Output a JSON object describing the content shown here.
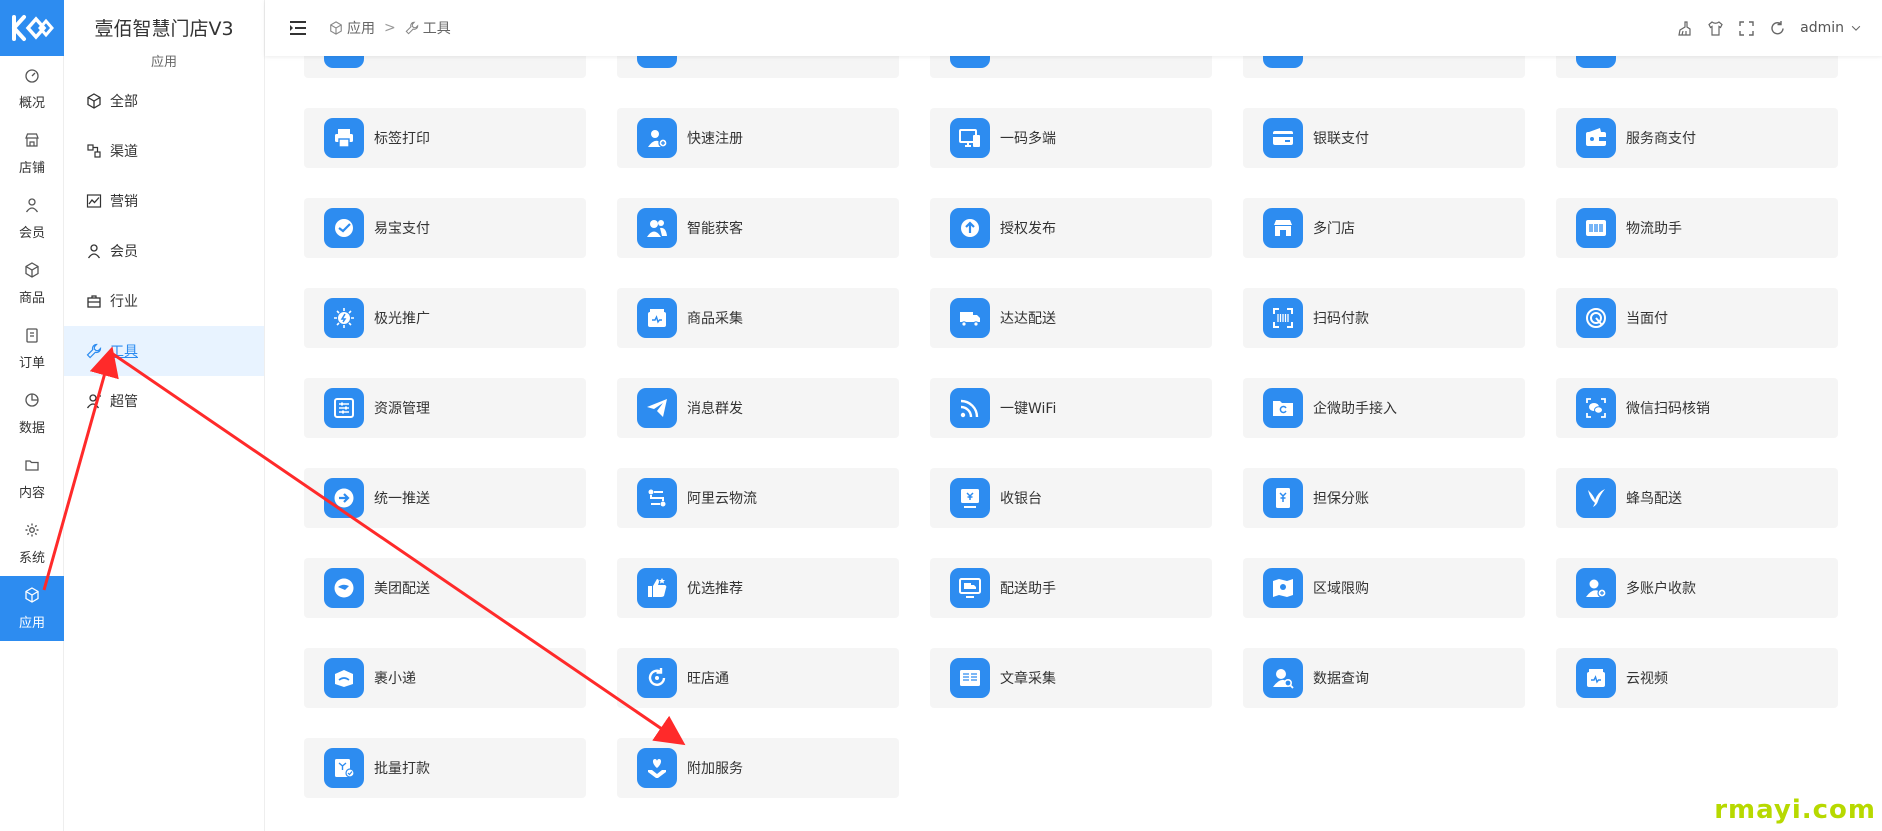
{
  "rail": {
    "items": [
      {
        "label": "概况",
        "icon": "dashboard-icon"
      },
      {
        "label": "店铺",
        "icon": "store-icon"
      },
      {
        "label": "会员",
        "icon": "user-icon"
      },
      {
        "label": "商品",
        "icon": "box-icon"
      },
      {
        "label": "订单",
        "icon": "order-icon"
      },
      {
        "label": "数据",
        "icon": "pie-icon"
      },
      {
        "label": "内容",
        "icon": "folder-icon"
      },
      {
        "label": "系统",
        "icon": "gear-icon"
      },
      {
        "label": "应用",
        "icon": "cube-icon",
        "active": true
      }
    ]
  },
  "brand": {
    "name": "壹佰智慧门店V3",
    "section": "应用"
  },
  "submenu": {
    "items": [
      {
        "label": "全部",
        "icon": "cube-icon"
      },
      {
        "label": "渠道",
        "icon": "channel-icon"
      },
      {
        "label": "营销",
        "icon": "chart-icon"
      },
      {
        "label": "会员",
        "icon": "user-icon"
      },
      {
        "label": "行业",
        "icon": "briefcase-icon"
      },
      {
        "label": "工具",
        "icon": "wrench-icon",
        "active": true
      },
      {
        "label": "超管",
        "icon": "admin-icon"
      }
    ]
  },
  "header": {
    "crumb1": "应用",
    "crumb_sep": ">",
    "crumb2": "工具",
    "user": "admin"
  },
  "apps": [
    {
      "label": "",
      "icon": "app-icon"
    },
    {
      "label": "",
      "icon": "app-icon"
    },
    {
      "label": "",
      "icon": "app-icon"
    },
    {
      "label": "",
      "icon": "app-icon"
    },
    {
      "label": "",
      "icon": "app-icon"
    },
    {
      "label": "标签打印",
      "icon": "printer-icon"
    },
    {
      "label": "快速注册",
      "icon": "user-add-icon"
    },
    {
      "label": "一码多端",
      "icon": "devices-icon"
    },
    {
      "label": "银联支付",
      "icon": "card-icon"
    },
    {
      "label": "服务商支付",
      "icon": "wallet-icon"
    },
    {
      "label": "易宝支付",
      "icon": "check-circle-icon"
    },
    {
      "label": "智能获客",
      "icon": "users-icon"
    },
    {
      "label": "授权发布",
      "icon": "upload-icon"
    },
    {
      "label": "多门店",
      "icon": "shops-icon"
    },
    {
      "label": "物流助手",
      "icon": "barcode-box-icon"
    },
    {
      "label": "极光推广",
      "icon": "aurora-icon"
    },
    {
      "label": "商品采集",
      "icon": "collect-icon"
    },
    {
      "label": "达达配送",
      "icon": "truck-icon"
    },
    {
      "label": "扫码付款",
      "icon": "scan-icon"
    },
    {
      "label": "当面付",
      "icon": "fingerprint-icon"
    },
    {
      "label": "资源管理",
      "icon": "sliders-icon"
    },
    {
      "label": "消息群发",
      "icon": "send-icon"
    },
    {
      "label": "一键WiFi",
      "icon": "wifi-icon"
    },
    {
      "label": "企微助手接入",
      "icon": "folder-sync-icon"
    },
    {
      "label": "微信扫码核销",
      "icon": "wechat-scan-icon"
    },
    {
      "label": "统一推送",
      "icon": "arrow-right-circle-icon"
    },
    {
      "label": "阿里云物流",
      "icon": "route-icon"
    },
    {
      "label": "收银台",
      "icon": "cashier-icon"
    },
    {
      "label": "担保分账",
      "icon": "yen-doc-icon"
    },
    {
      "label": "蜂鸟配送",
      "icon": "bird-icon"
    },
    {
      "label": "美团配送",
      "icon": "meituan-icon"
    },
    {
      "label": "优选推荐",
      "icon": "thumbs-up-icon"
    },
    {
      "label": "配送助手",
      "icon": "monitor-truck-icon"
    },
    {
      "label": "区域限购",
      "icon": "map-pin-icon"
    },
    {
      "label": "多账户收款",
      "icon": "user-money-icon"
    },
    {
      "label": "裹小递",
      "icon": "parcel-icon"
    },
    {
      "label": "旺店通",
      "icon": "refresh-circle-icon"
    },
    {
      "label": "文章采集",
      "icon": "article-icon"
    },
    {
      "label": "数据查询",
      "icon": "user-search-icon"
    },
    {
      "label": "云视频",
      "icon": "video-box-icon"
    },
    {
      "label": "批量打款",
      "icon": "batch-pay-icon"
    },
    {
      "label": "附加服务",
      "icon": "heart-hand-icon"
    }
  ],
  "watermark": "rmayi.com",
  "colors": {
    "accent": "#2d8cf0",
    "card_bg": "#f5f5f5",
    "annotation": "#ff2a2a"
  }
}
